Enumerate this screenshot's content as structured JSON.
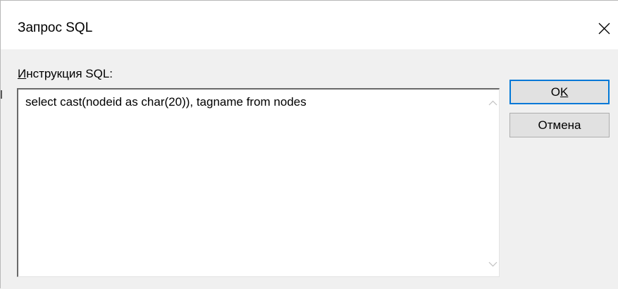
{
  "window": {
    "title": "Запрос SQL"
  },
  "icons": {
    "close": "close-icon",
    "scroll_up": "scroll-up-arrow-icon",
    "scroll_down": "scroll-down-arrow-icon"
  },
  "sql_label": {
    "accesskey": "И",
    "rest": "нструкция SQL:"
  },
  "sql_text": "select cast(nodeid as char(20)), tagname from nodes",
  "buttons": {
    "ok": {
      "prefix": "O",
      "accesskey": "K"
    },
    "cancel": "Отмена"
  },
  "colors": {
    "ok_focus_border": "#0078d7",
    "dialog_bg": "#f0f0f0",
    "titlebar_bg": "#ffffff"
  }
}
